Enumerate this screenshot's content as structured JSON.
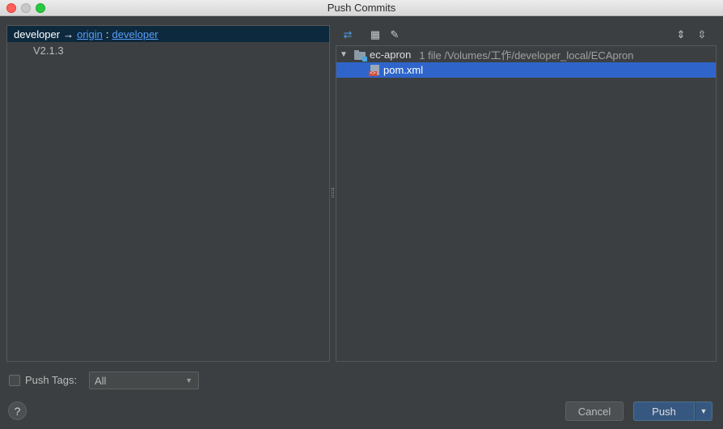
{
  "window": {
    "title": "Push Commits"
  },
  "left": {
    "branch": {
      "local": "developer",
      "arrow": "→",
      "remote": "origin",
      "sep": ":",
      "remote_branch": "developer"
    },
    "commit": "V2.1.3"
  },
  "toolbar": {
    "icons": [
      "diff-icon",
      "group-icon",
      "edit-icon",
      "expand-all-icon",
      "collapse-all-icon"
    ],
    "glyphs": {
      "diff": "⇄",
      "group": "▦",
      "edit": "✎",
      "expand": "⇕",
      "collapse": "⇳"
    }
  },
  "tree": {
    "arrow": "▼",
    "root_name": "ec-apron",
    "root_meta": "1 file  /Volumes/工作/developer_local/ECApron",
    "file_name": "pom.xml"
  },
  "bottom": {
    "push_tags_label": "Push Tags:",
    "tags_select_value": "All",
    "help": "?",
    "cancel": "Cancel",
    "push": "Push",
    "push_dd": "▼",
    "select_chev": "▼"
  },
  "colors": {
    "selection": "#2f65ca",
    "branch_row": "#0d293e",
    "link": "#589df6",
    "push": "#365880"
  }
}
